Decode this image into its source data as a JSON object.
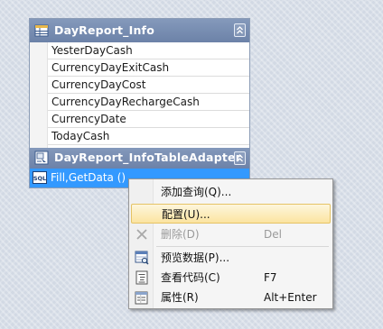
{
  "table": {
    "title": "DayReport_Info",
    "columns": [
      "YesterDayCash",
      "CurrencyDayExitCash",
      "CurrencyDayCost",
      "CurrencyDayRechargeCash",
      "CurrencyDate",
      "TodayCash"
    ]
  },
  "adapter": {
    "title": "DayReport_InfoTableAdapter",
    "query": "Fill,GetData ()"
  },
  "context_menu": {
    "items": [
      {
        "label": "添加查询(Q)...",
        "shortcut": "",
        "icon": "none",
        "state": "normal"
      },
      {
        "label": "配置(U)...",
        "shortcut": "",
        "icon": "none",
        "state": "hovered"
      },
      {
        "label": "删除(D)",
        "shortcut": "Del",
        "icon": "delete-x-icon",
        "state": "disabled"
      },
      {
        "label": "预览数据(P)...",
        "shortcut": "",
        "icon": "preview-data-icon",
        "state": "normal"
      },
      {
        "label": "查看代码(C)",
        "shortcut": "F7",
        "icon": "view-code-icon",
        "state": "normal"
      },
      {
        "label": "属性(R)",
        "shortcut": "Alt+Enter",
        "icon": "properties-icon",
        "state": "normal"
      }
    ]
  },
  "colors": {
    "header_blue": "#7389ae",
    "selection_blue": "#3399ff",
    "menu_hover": "#fbe4a0"
  }
}
